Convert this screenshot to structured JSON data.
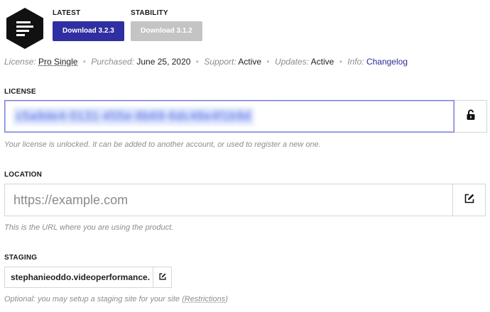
{
  "downloads": {
    "latest": {
      "label": "LATEST",
      "button": "Download 3.2.3",
      "color": "#2f2fa2"
    },
    "stability": {
      "label": "STABILITY",
      "button": "Download 3.1.2",
      "color": "#c4c4c4"
    }
  },
  "meta": {
    "license_label": "License:",
    "license_value": "Pro Single",
    "purchased_label": "Purchased:",
    "purchased_value": "June 25, 2020",
    "support_label": "Support:",
    "support_value": "Active",
    "updates_label": "Updates:",
    "updates_value": "Active",
    "info_label": "Info:",
    "info_link": "Changelog",
    "separator": "•"
  },
  "license": {
    "label": "LICENSE",
    "key": "c5a9de4-0131-455e-8b69-6dc48e4f1b9d",
    "help": "Your license is unlocked. It can be added to another account, or used to register a new one.",
    "icon": "unlock-icon"
  },
  "location": {
    "label": "LOCATION",
    "placeholder": "https://example.com",
    "help": "This is the URL where you are using the product.",
    "icon": "edit-icon"
  },
  "staging": {
    "label": "STAGING",
    "value": "stephanieoddo.videoperformance.",
    "help_prefix": "Optional: you may setup a staging site for your site (",
    "help_link": "Restrictions",
    "help_suffix": ")",
    "icon": "edit-icon"
  },
  "colors": {
    "accent": "#2f2fa2",
    "focus_border": "#7a7de0",
    "muted": "#8d8d8d"
  }
}
